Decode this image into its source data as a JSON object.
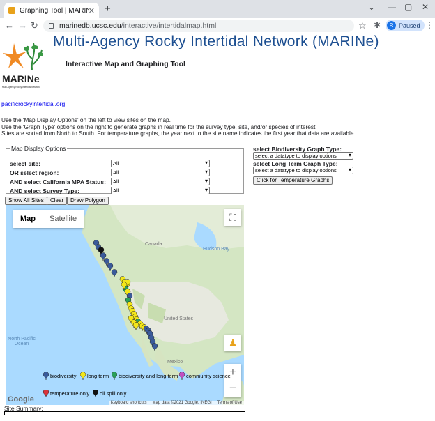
{
  "browser": {
    "tab_title": "Graphing Tool | MARINe",
    "url_host": "marinedb.ucsc.edu",
    "url_path": "/interactive/intertidalmap.html",
    "profile_initial": "R",
    "profile_status": "Paused"
  },
  "header": {
    "title": "Multi-Agency Rocky Intertidal Network (MARINe)",
    "subtitle": "Interactive Map and Graphing Tool",
    "logo_text": "MARINe",
    "logo_tagline": "Multi-Agency Rocky Intertidal Network"
  },
  "site_link": "pacificrockyintertidal.org",
  "instructions": [
    "Use the 'Map Display Options' on the left to view sites on the map.",
    "Use the 'Graph Type' options on the right to generate graphs in real time for the survey type, site, and/or species of interest.",
    "Sites are sorted from North to South. For temperature graphs, the year next to the site name indicates the first year that data are available."
  ],
  "display_options": {
    "legend": "Map Display Options",
    "site_label": "select site:",
    "site_value": "All",
    "region_label": "OR select region:",
    "region_value": "All",
    "mpa_label": "AND select California MPA Status:",
    "mpa_value": "All",
    "survey_label": "AND select Survey Type:",
    "survey_value": "All"
  },
  "graph_options": {
    "biodiversity_label": "select Biodiversity Graph Type:",
    "biodiversity_value": "select a datatype to display options",
    "longterm_label": "select Long Term Graph Type:",
    "longterm_value": "select a datatype to display options",
    "temperature_button": "Click for Temperature Graphs"
  },
  "buttons": {
    "show_all": "Show All Sites",
    "clear": "Clear",
    "draw_polygon": "Draw Polygon"
  },
  "map": {
    "type_map": "Map",
    "type_satellite": "Satellite",
    "labels": {
      "canada": "Canada",
      "us": "United States",
      "mexico": "Mexico",
      "hudson": "Hudson Bay",
      "pacific": "North Pacific Ocean"
    },
    "legend": [
      {
        "label": "biodiversity",
        "color": "#3a5a9a"
      },
      {
        "label": "long term",
        "color": "#f3e61a"
      },
      {
        "label": "biodiversity and long term",
        "color": "#2aa05a"
      },
      {
        "label": "community science",
        "color": "#c24fc0"
      },
      {
        "label": "temperature only",
        "color": "#d8323a"
      },
      {
        "label": "oil spill only",
        "color": "#111111"
      }
    ],
    "attribution": {
      "shortcuts": "Keyboard shortcuts",
      "data": "Map data ©2021 Google, INEGI",
      "terms": "Terms of Use"
    },
    "google": "Google"
  },
  "summary_label": "Site Summary:"
}
